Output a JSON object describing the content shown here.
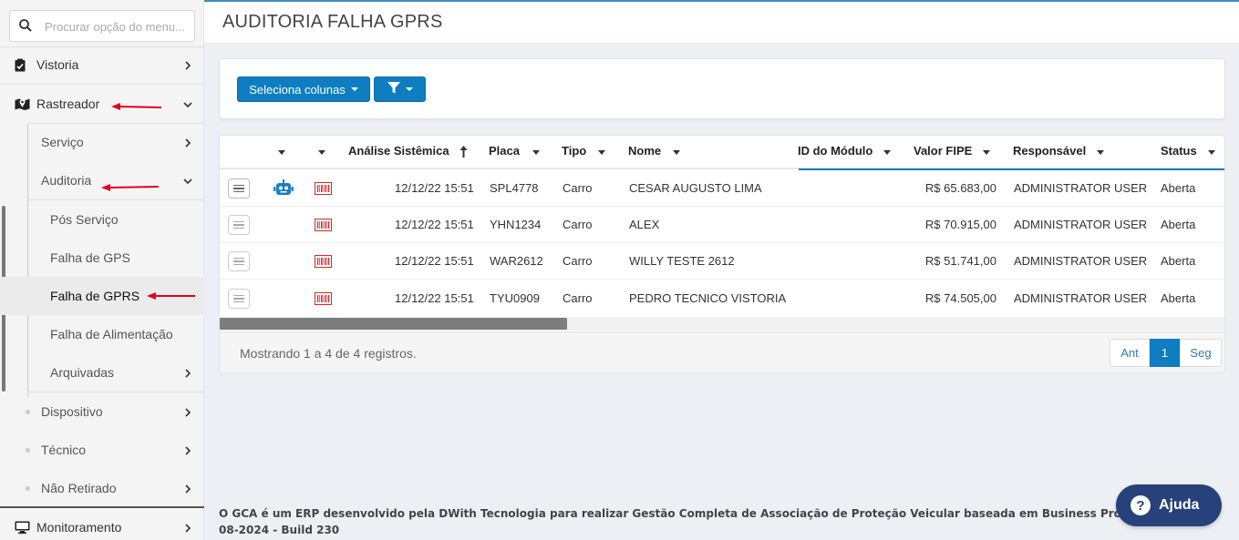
{
  "sidebar": {
    "search_placeholder": "Procurar opção do menu...",
    "items": {
      "vistoria": "Vistoria",
      "rastreador": "Rastreador",
      "servico": "Serviço",
      "auditoria": "Auditoria",
      "pos_servico": "Pós Serviço",
      "falha_gps": "Falha de GPS",
      "falha_gprs": "Falha de GPRS",
      "falha_alimentacao": "Falha de Alimentação",
      "arquivadas": "Arquivadas",
      "dispositivo": "Dispositivo",
      "tecnico": "Técnico",
      "nao_retirado": "Não Retirado",
      "monitoramento": "Monitoramento"
    }
  },
  "header": {
    "title": "AUDITORIA FALHA GPRS"
  },
  "toolbar": {
    "select_columns": "Seleciona colunas"
  },
  "table": {
    "columns": {
      "analise": "Análise Sistêmica",
      "placa": "Placa",
      "tipo": "Tipo",
      "nome": "Nome",
      "modulo": "ID do Módulo",
      "fipe": "Valor FIPE",
      "responsavel": "Responsável",
      "status": "Status"
    },
    "rows": [
      {
        "analise": "12/12/22 15:51",
        "placa": "SPL4778",
        "tipo": "Carro",
        "nome": "CESAR AUGUSTO LIMA",
        "modulo": "",
        "fipe": "R$ 65.683,00",
        "responsavel": "ADMINISTRATOR USER",
        "status": "Aberta"
      },
      {
        "analise": "12/12/22 15:51",
        "placa": "YHN1234",
        "tipo": "Carro",
        "nome": "ALEX",
        "modulo": "",
        "fipe": "R$ 70.915,00",
        "responsavel": "ADMINISTRATOR USER",
        "status": "Aberta"
      },
      {
        "analise": "12/12/22 15:51",
        "placa": "WAR2612",
        "tipo": "Carro",
        "nome": "WILLY TESTE 2612",
        "modulo": "",
        "fipe": "R$ 51.741,00",
        "responsavel": "ADMINISTRATOR USER",
        "status": "Aberta"
      },
      {
        "analise": "12/12/22 15:51",
        "placa": "TYU0909",
        "tipo": "Carro",
        "nome": "PEDRO TECNICO VISTORIA",
        "modulo": "",
        "fipe": "R$ 74.505,00",
        "responsavel": "ADMINISTRATOR USER",
        "status": "Aberta"
      }
    ],
    "showing": "Mostrando 1 a 4 de 4 registros.",
    "pager": {
      "prev": "Ant",
      "current": "1",
      "next": "Seg"
    }
  },
  "footer": {
    "line1": "O GCA é um ERP desenvolvido pela DWith Tecnologia para realizar Gestão Completa de Associação de Proteção Veicular baseada em Business Process Manageme",
    "line2": "08-2024 - Build 230"
  },
  "help": {
    "label": "Ajuda"
  },
  "colors": {
    "primary": "#0e7ec1",
    "help": "#27417a",
    "arrow": "#e3001b",
    "barcode": "#cc2b2b",
    "robot": "#1a7fc6"
  }
}
